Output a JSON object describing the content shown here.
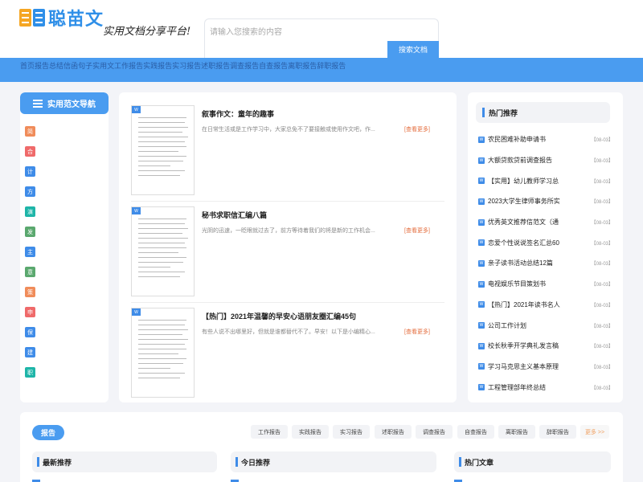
{
  "header": {
    "logo_text": "聪苗文",
    "slogan": "实用文档分享平台!",
    "search_placeholder": "请输入您搜索的内容",
    "search_button": "搜索文档"
  },
  "nav": {
    "links": [
      "首页",
      "报告",
      "总结",
      "信函",
      "句子",
      "实用文",
      "工作报告",
      "实践报告",
      "实习报告",
      "述职报告",
      "调查报告",
      "自查报告",
      "离职报告",
      "辞职报告"
    ]
  },
  "sidebar": {
    "title": "实用范文导航",
    "items": [
      {
        "label": "简",
        "color": "#f08c5a"
      },
      {
        "label": "合",
        "color": "#ef6a6a"
      },
      {
        "label": "计",
        "color": "#3f8ce8"
      },
      {
        "label": "方",
        "color": "#3f8ce8"
      },
      {
        "label": "演",
        "color": "#1eb5a8"
      },
      {
        "label": "发",
        "color": "#5aa86e"
      },
      {
        "label": "主",
        "color": "#3f8ce8"
      },
      {
        "label": "意",
        "color": "#5aa86e"
      },
      {
        "label": "策",
        "color": "#f08c5a"
      },
      {
        "label": "申",
        "color": "#ef6a6a"
      },
      {
        "label": "保",
        "color": "#3f8ce8"
      },
      {
        "label": "建",
        "color": "#3f8ce8"
      },
      {
        "label": "职",
        "color": "#1eb5a8"
      }
    ]
  },
  "docs": [
    {
      "title": "叙事作文：童年的趣事",
      "desc": "在日常生活或是工作学习中，大家总免不了要接触或使用作文吧，作...",
      "more": "[查看更多]"
    },
    {
      "title": "秘书求职信汇编八篇",
      "desc": "光阴的迅速，一眨眼就过去了，前方等待着我们的将是新的工作机会...",
      "more": "[查看更多]"
    },
    {
      "title": "【热门】2021年温馨的早安心语朋友圈汇编45句",
      "desc": "有些人说不出哪里好，但就是谁都替代不了。早安！以下是小编精心...",
      "more": "[查看更多]"
    }
  ],
  "hot": {
    "title": "热门推荐",
    "items": [
      {
        "title": "农民困难补助申请书",
        "date": "【08-03】"
      },
      {
        "title": "大额贷款贷前调查报告",
        "date": "【08-03】"
      },
      {
        "title": "【实用】幼儿教师学习总",
        "date": "【08-03】"
      },
      {
        "title": "2023大学生律师事务所实",
        "date": "【08-03】"
      },
      {
        "title": "优秀英文推荐信范文（通",
        "date": "【08-03】"
      },
      {
        "title": "恋爱个性说说签名汇总60",
        "date": "【08-03】"
      },
      {
        "title": "亲子读书活动总结12篇",
        "date": "【08-03】"
      },
      {
        "title": "电视娱乐节目策划书",
        "date": "【08-03】"
      },
      {
        "title": "【热门】2021年读书名人",
        "date": "【08-03】"
      },
      {
        "title": "公司工作计划",
        "date": "【08-03】"
      },
      {
        "title": "校长秋季开学典礼发言稿",
        "date": "【08-03】"
      },
      {
        "title": "学习马克思主义基本原理",
        "date": "【08-03】"
      },
      {
        "title": "工程管理部年终总结",
        "date": "【08-03】"
      }
    ]
  },
  "bottom": {
    "section_label": "报告",
    "tags": [
      "工作报告",
      "实践报告",
      "实习报告",
      "述职报告",
      "调查报告",
      "自查报告",
      "离职报告",
      "辞职报告"
    ],
    "more": "更多 >>",
    "panels": [
      "最新推荐",
      "今日推荐",
      "热门文章"
    ]
  },
  "colors": {
    "accent": "#4a9cf0",
    "more_link": "#e46c3c"
  }
}
